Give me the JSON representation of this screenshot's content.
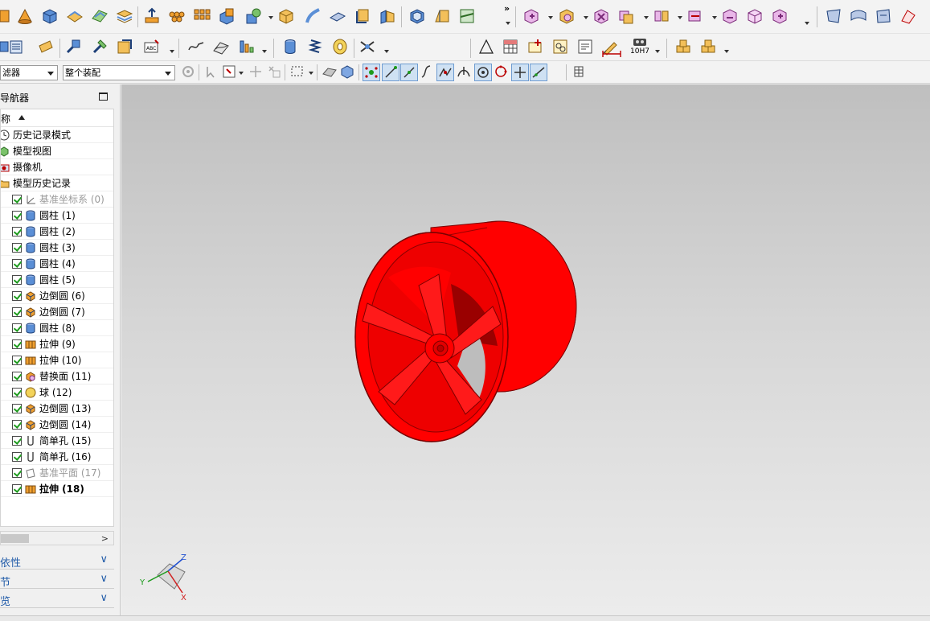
{
  "selection_filter": {
    "value": "滤器"
  },
  "assembly_scope": {
    "value": "整个装配"
  },
  "toolbar": {
    "more_label": "»",
    "measure_fit_label": "10H7"
  },
  "navigator": {
    "title": "导航器",
    "column_header": "称",
    "items": [
      {
        "label": "历史记录模式",
        "icon": "clock-icon",
        "checked": false,
        "dim": false,
        "bold": false,
        "level": 0
      },
      {
        "label": "模型视图",
        "icon": "model-views-icon",
        "checked": false,
        "dim": false,
        "bold": false,
        "level": 0
      },
      {
        "label": "摄像机",
        "icon": "camera-icon",
        "checked": false,
        "dim": false,
        "bold": false,
        "level": 0
      },
      {
        "label": "模型历史记录",
        "icon": "folder-icon",
        "checked": false,
        "dim": false,
        "bold": false,
        "level": 0
      },
      {
        "label": "基准坐标系 (0)",
        "icon": "datum-csys-icon",
        "checked": true,
        "dim": true,
        "bold": false,
        "level": 1
      },
      {
        "label": "圆柱 (1)",
        "icon": "cylinder-icon",
        "checked": true,
        "dim": false,
        "bold": false,
        "level": 1
      },
      {
        "label": "圆柱 (2)",
        "icon": "cylinder-icon",
        "checked": true,
        "dim": false,
        "bold": false,
        "level": 1
      },
      {
        "label": "圆柱 (3)",
        "icon": "cylinder-icon",
        "checked": true,
        "dim": false,
        "bold": false,
        "level": 1
      },
      {
        "label": "圆柱 (4)",
        "icon": "cylinder-icon",
        "checked": true,
        "dim": false,
        "bold": false,
        "level": 1
      },
      {
        "label": "圆柱 (5)",
        "icon": "cylinder-icon",
        "checked": true,
        "dim": false,
        "bold": false,
        "level": 1
      },
      {
        "label": "边倒圆 (6)",
        "icon": "edge-blend-icon",
        "checked": true,
        "dim": false,
        "bold": false,
        "level": 1
      },
      {
        "label": "边倒圆 (7)",
        "icon": "edge-blend-icon",
        "checked": true,
        "dim": false,
        "bold": false,
        "level": 1
      },
      {
        "label": "圆柱 (8)",
        "icon": "cylinder-icon",
        "checked": true,
        "dim": false,
        "bold": false,
        "level": 1
      },
      {
        "label": "拉伸 (9)",
        "icon": "extrude-icon",
        "checked": true,
        "dim": false,
        "bold": false,
        "level": 1
      },
      {
        "label": "拉伸 (10)",
        "icon": "extrude-icon",
        "checked": true,
        "dim": false,
        "bold": false,
        "level": 1
      },
      {
        "label": "替换面 (11)",
        "icon": "replace-face-icon",
        "checked": true,
        "dim": false,
        "bold": false,
        "level": 1
      },
      {
        "label": "球 (12)",
        "icon": "sphere-icon",
        "checked": true,
        "dim": false,
        "bold": false,
        "level": 1
      },
      {
        "label": "边倒圆 (13)",
        "icon": "edge-blend-icon",
        "checked": true,
        "dim": false,
        "bold": false,
        "level": 1
      },
      {
        "label": "边倒圆 (14)",
        "icon": "edge-blend-icon",
        "checked": true,
        "dim": false,
        "bold": false,
        "level": 1
      },
      {
        "label": "简单孔 (15)",
        "icon": "hole-icon",
        "checked": true,
        "dim": false,
        "bold": false,
        "level": 1
      },
      {
        "label": "简单孔 (16)",
        "icon": "hole-icon",
        "checked": true,
        "dim": false,
        "bold": false,
        "level": 1
      },
      {
        "label": "基准平面 (17)",
        "icon": "datum-plane-icon",
        "checked": true,
        "dim": true,
        "bold": false,
        "level": 1
      },
      {
        "label": "拉伸 (18)",
        "icon": "extrude-icon",
        "checked": true,
        "dim": false,
        "bold": true,
        "level": 1
      }
    ],
    "panels": [
      {
        "label": "依性"
      },
      {
        "label": "节"
      },
      {
        "label": "览"
      }
    ]
  },
  "triad": {
    "x_label": "X",
    "y_label": "Y",
    "z_label": "Z"
  },
  "colors": {
    "model": "#ff0000",
    "model_edge": "#7a0000",
    "viewport_top": "#bfbfbf",
    "viewport_bottom": "#ececec",
    "check_green": "#1c9a1c",
    "panel_text": "#1f5aa8"
  }
}
